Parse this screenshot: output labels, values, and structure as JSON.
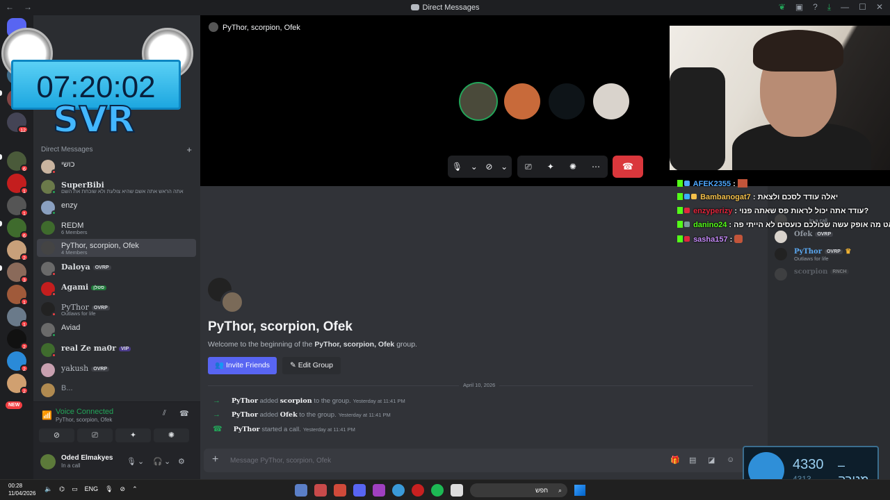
{
  "window": {
    "title": "Direct Messages"
  },
  "overlay": {
    "timer": "07:20:02",
    "tag": "SVR"
  },
  "servers": {
    "badges": [
      "5",
      "12",
      "6",
      "1",
      "1",
      "6",
      "2",
      "3",
      "1",
      "1",
      "2",
      "2",
      "2"
    ],
    "new_label": "NEW"
  },
  "dm": {
    "header": "Direct Messages",
    "items": [
      {
        "name": "כושי",
        "sub": ""
      },
      {
        "name": "SuperBibi",
        "sub": "אתה הראש אתה אשם שהיא צולעת ולא שוכחת את השם"
      },
      {
        "name": "enzy",
        "sub": ""
      },
      {
        "name": "REDM",
        "sub": "6 Members"
      },
      {
        "name": "PyThor, scorpion, Ofek",
        "sub": "4 Members"
      },
      {
        "name": "Daloya",
        "tag": "OVRP",
        "sub": ""
      },
      {
        "name": "Agami",
        "tag": "סטלן",
        "sub": ""
      },
      {
        "name": "PyThor",
        "tag": "OVRP",
        "sub": "Outlaws for life"
      },
      {
        "name": "Aviad",
        "sub": ""
      },
      {
        "name": "real Ze ma0r",
        "tag": "VIP",
        "sub": ""
      },
      {
        "name": "yakush",
        "tag": "OVRP",
        "sub": ""
      },
      {
        "name": "B...",
        "sub": ""
      }
    ]
  },
  "voice": {
    "status": "Voice Connected",
    "channel": "PyThor, scorpion, Ofek"
  },
  "user": {
    "name": "Oded Elmakyes",
    "status": "In a call"
  },
  "call": {
    "title": "PyThor, scorpion, Ofek"
  },
  "chat": {
    "welcome_title": "PyThor, scorpion, Ofek",
    "welcome_pre": "Welcome to the beginning of the ",
    "welcome_bold": "PyThor, scorpion, Ofek",
    "welcome_post": " group.",
    "invite_label": "Invite Friends",
    "edit_label": "Edit Group",
    "date_divider": "April 10, 2026",
    "messages": [
      {
        "author": "PyThor",
        "verb": "added",
        "target": "scorpion",
        "rest": "to the group.",
        "time": "Yesterday at 11:41 PM"
      },
      {
        "author": "PyThor",
        "verb": "added",
        "target": "Ofek",
        "rest": "to the group.",
        "time": "Yesterday at 11:41 PM"
      },
      {
        "author": "PyThor",
        "verb": "started a call.",
        "target": "",
        "rest": "",
        "time": "Yesterday at 11:41 PM"
      }
    ],
    "composer_placeholder": "Message PyThor, scorpion, Ofek"
  },
  "members": [
    {
      "name": "Ofek",
      "sub": "",
      "tag": "OVRP"
    },
    {
      "name": "PyThor",
      "sub": "Outlaws for life",
      "tag": "OVRP"
    },
    {
      "name": "scorpion",
      "sub": "",
      "tag": "RNCH"
    }
  ],
  "member_status_top": "In a call",
  "streamchat": [
    {
      "user": "AFEK2355",
      "msg": ":",
      "color": "#4ea8ff"
    },
    {
      "user": "Bambanogat7",
      "msg": ": יאלה עודד לסכם ולצאת",
      "color": "#f4c04a"
    },
    {
      "user": "enzyperizy",
      "msg": ": עודד אתה יכול לראות פס שאתה פנוי?",
      "color": "#e0263c"
    },
    {
      "user": "danino24",
      "msg": ": צאט מה אופק עשה שכולכם כועסים לא הייתי פה",
      "color": "#53fc18"
    },
    {
      "user": "sasha157",
      "msg": ":",
      "color": "#c58af9"
    }
  ],
  "goal": {
    "current": "4330",
    "label": "מטרה",
    "count": "4313"
  },
  "taskbar": {
    "time": "00:28",
    "date": "11/04/2026",
    "lang": "ENG",
    "search": "חפש"
  },
  "colors": {
    "accent": "#5865f2",
    "online": "#23a559",
    "danger": "#da373c"
  }
}
